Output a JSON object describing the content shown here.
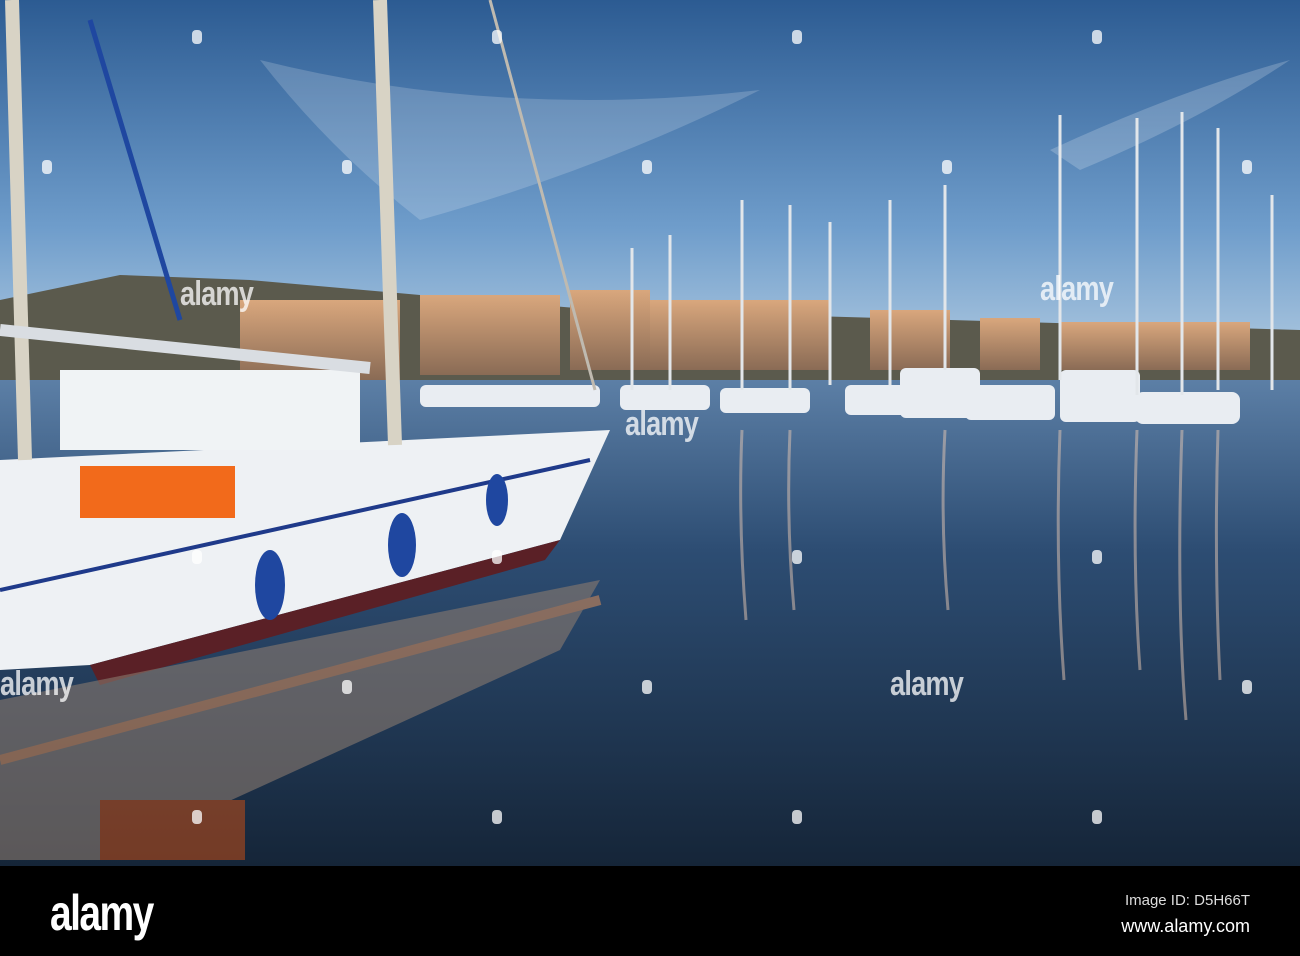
{
  "watermark": {
    "text": "alamy"
  },
  "footer": {
    "logo": "alamy",
    "image_id": "Image ID: D5H66T",
    "url": "www.alamy.com"
  },
  "colors": {
    "sky_top": "#2f5f96",
    "sky_low": "#9fc1de",
    "water": "#1f3550",
    "hull": "#eef1f4",
    "cover": "#f26a1b",
    "fender": "#1f47a0"
  }
}
